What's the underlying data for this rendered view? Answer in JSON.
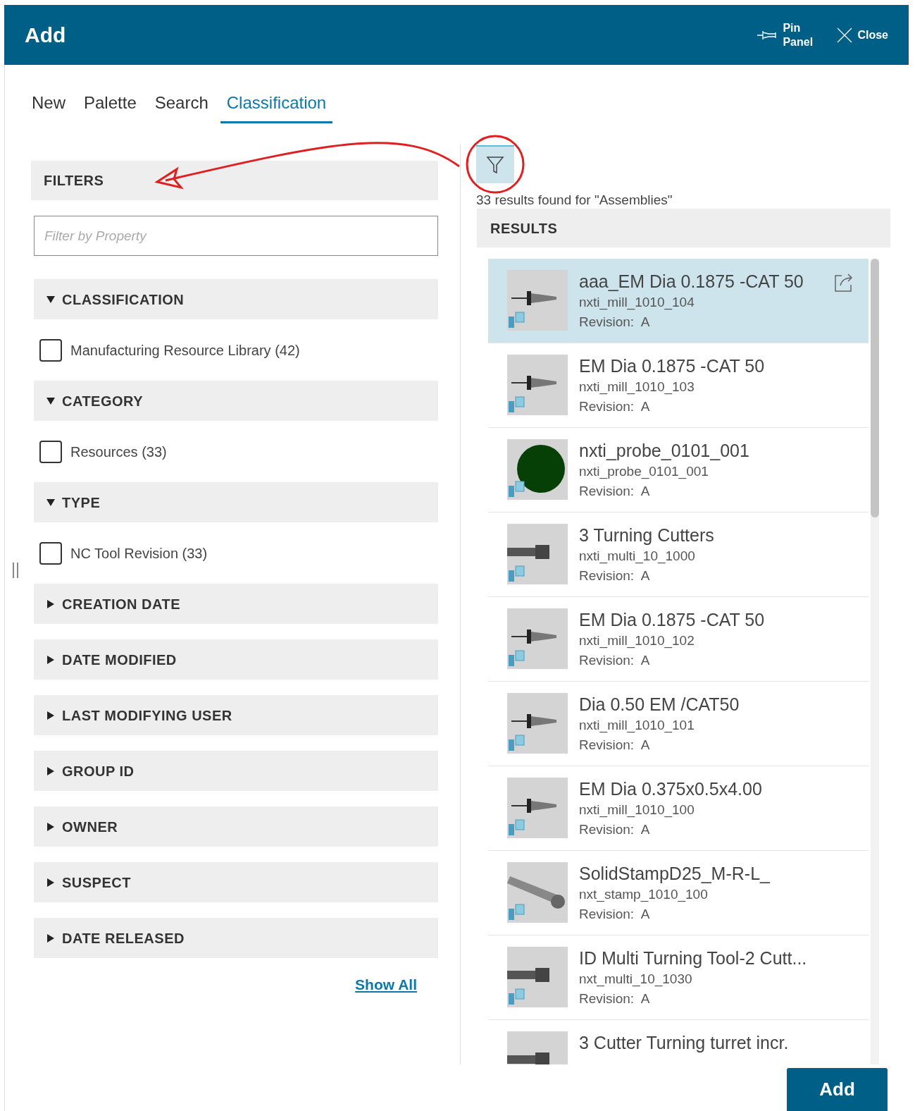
{
  "header": {
    "title": "Add",
    "actions": [
      {
        "kind": "pin",
        "label": "Pin Panel"
      },
      {
        "kind": "close",
        "label": "Close"
      }
    ]
  },
  "tabs": [
    {
      "label": "New",
      "selected": false
    },
    {
      "label": "Palette",
      "selected": false
    },
    {
      "label": "Search",
      "selected": false
    },
    {
      "label": "Classification",
      "selected": true
    }
  ],
  "filters": {
    "title": "FILTERS",
    "placeholder": "Filter by Property",
    "groups": [
      {
        "label": "CLASSIFICATION",
        "expanded": true,
        "options": [
          {
            "label": "Manufacturing Resource Library (42)",
            "checked": false
          }
        ]
      },
      {
        "label": "CATEGORY",
        "expanded": true,
        "options": [
          {
            "label": "Resources (33)",
            "checked": false
          }
        ]
      },
      {
        "label": "TYPE",
        "expanded": true,
        "options": [
          {
            "label": "NC Tool Revision (33)",
            "checked": false
          }
        ]
      },
      {
        "label": "CREATION DATE",
        "expanded": false
      },
      {
        "label": "DATE MODIFIED",
        "expanded": false
      },
      {
        "label": "LAST MODIFYING USER",
        "expanded": false
      },
      {
        "label": "GROUP ID",
        "expanded": false
      },
      {
        "label": "OWNER",
        "expanded": false
      },
      {
        "label": "SUSPECT",
        "expanded": false
      },
      {
        "label": "DATE RELEASED",
        "expanded": false
      }
    ],
    "show_all": "Show All"
  },
  "results": {
    "summary": "33 results found for \"Assemblies\"",
    "title": "RESULTS",
    "items": [
      {
        "kind": "mill",
        "title": "aaa_EM Dia 0.1875 -CAT 50",
        "id": "nxti_mill_1010_104",
        "revision_label": "Revision:",
        "revision": "A",
        "selected": true
      },
      {
        "kind": "mill",
        "title": "EM Dia 0.1875 -CAT 50",
        "id": "nxti_mill_1010_103",
        "revision_label": "Revision:",
        "revision": "A",
        "selected": false
      },
      {
        "kind": "probe",
        "title": "nxti_probe_0101_001",
        "id": "nxti_probe_0101_001",
        "revision_label": "Revision:",
        "revision": "A",
        "selected": false
      },
      {
        "kind": "turning",
        "title": "3 Turning Cutters",
        "id": "nxti_multi_10_1000",
        "revision_label": "Revision:",
        "revision": "A",
        "selected": false
      },
      {
        "kind": "mill",
        "title": "EM Dia 0.1875 -CAT 50",
        "id": "nxti_mill_1010_102",
        "revision_label": "Revision:",
        "revision": "A",
        "selected": false
      },
      {
        "kind": "mill",
        "title": "Dia 0.50 EM /CAT50",
        "id": "nxti_mill_1010_101",
        "revision_label": "Revision:",
        "revision": "A",
        "selected": false
      },
      {
        "kind": "mill",
        "title": "EM Dia 0.375x0.5x4.00",
        "id": "nxti_mill_1010_100",
        "revision_label": "Revision:",
        "revision": "A",
        "selected": false
      },
      {
        "kind": "stamp",
        "title": "SolidStampD25_M-R-L_",
        "id": "nxt_stamp_1010_100",
        "revision_label": "Revision:",
        "revision": "A",
        "selected": false
      },
      {
        "kind": "turning",
        "title": "ID Multi Turning Tool-2 Cutt...",
        "id": "nxt_multi_10_1030",
        "revision_label": "Revision:",
        "revision": "A",
        "selected": false
      },
      {
        "kind": "turning",
        "title": "3 Cutter Turning turret incr.",
        "selected": false
      }
    ]
  },
  "add_button": "Add"
}
